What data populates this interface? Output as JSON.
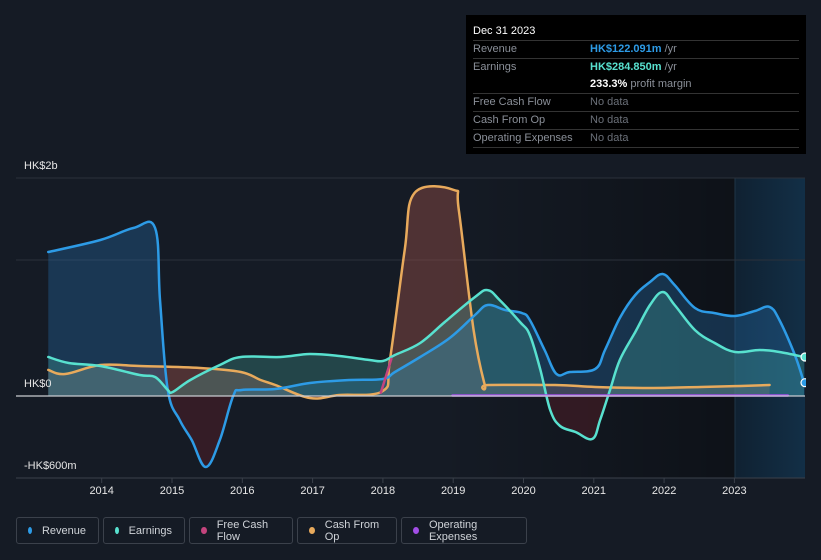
{
  "tooltip": {
    "date": "Dec 31 2023",
    "rows": [
      {
        "label": "Revenue",
        "value": "HK$122.091m",
        "suffix": " /yr",
        "color": "#2d9be6"
      },
      {
        "label": "Earnings",
        "value": "HK$284.850m",
        "suffix": " /yr",
        "color": "#58e1cf"
      },
      {
        "label": "",
        "value": "233.3%",
        "suffix": " profit margin",
        "color": "#ffffff"
      },
      {
        "label": "Free Cash Flow",
        "value": "No data",
        "suffix": "",
        "color": "#6b7079"
      },
      {
        "label": "Cash From Op",
        "value": "No data",
        "suffix": "",
        "color": "#6b7079"
      },
      {
        "label": "Operating Expenses",
        "value": "No data",
        "suffix": "",
        "color": "#6b7079"
      }
    ]
  },
  "legend": [
    {
      "label": "Revenue",
      "color": "#2d9be6"
    },
    {
      "label": "Earnings",
      "color": "#58e1cf"
    },
    {
      "label": "Free Cash Flow",
      "color": "#c4447d"
    },
    {
      "label": "Cash From Op",
      "color": "#e8aa5c"
    },
    {
      "label": "Operating Expenses",
      "color": "#a24ee6"
    }
  ],
  "chart_data": {
    "type": "area",
    "title": "",
    "xlabel": "",
    "ylabel": "",
    "currency": "HK$",
    "units": "millions",
    "y_tick_labels": [
      "HK$2b",
      "HK$0",
      "-HK$600m"
    ],
    "y_ticks": [
      2000,
      0,
      -600
    ],
    "ylim": [
      -750,
      2000
    ],
    "x_tick_labels": [
      "2014",
      "2015",
      "2016",
      "2017",
      "2018",
      "2019",
      "2020",
      "2021",
      "2022",
      "2023"
    ],
    "x_ticks": [
      2014,
      2015,
      2016,
      2017,
      2018,
      2019,
      2020,
      2021,
      2022,
      2023
    ],
    "xlim": [
      2012.54,
      2024.08
    ],
    "forecast_start": 2023.0,
    "grid": true,
    "legend_position": "bottom",
    "series": [
      {
        "name": "Revenue",
        "color": "#2d9be6",
        "points": [
          [
            2013.24,
            1321
          ],
          [
            2013.98,
            1431
          ],
          [
            2014.45,
            1541
          ],
          [
            2014.76,
            1541
          ],
          [
            2014.83,
            881
          ],
          [
            2014.94,
            55
          ],
          [
            2015.11,
            -220
          ],
          [
            2015.28,
            -404
          ],
          [
            2015.48,
            -651
          ],
          [
            2015.68,
            -404
          ],
          [
            2015.87,
            0
          ],
          [
            2015.99,
            55
          ],
          [
            2016.47,
            64
          ],
          [
            2016.96,
            119
          ],
          [
            2017.53,
            147
          ],
          [
            2018.0,
            156
          ],
          [
            2018.17,
            220
          ],
          [
            2018.53,
            358
          ],
          [
            2018.95,
            532
          ],
          [
            2019.31,
            743
          ],
          [
            2019.49,
            835
          ],
          [
            2019.74,
            789
          ],
          [
            2019.98,
            761
          ],
          [
            2020.09,
            697
          ],
          [
            2020.3,
            422
          ],
          [
            2020.47,
            202
          ],
          [
            2020.66,
            220
          ],
          [
            2021.02,
            248
          ],
          [
            2021.16,
            422
          ],
          [
            2021.37,
            716
          ],
          [
            2021.59,
            927
          ],
          [
            2021.8,
            1046
          ],
          [
            2021.98,
            1119
          ],
          [
            2022.15,
            1018
          ],
          [
            2022.44,
            807
          ],
          [
            2022.72,
            761
          ],
          [
            2023.01,
            734
          ],
          [
            2023.29,
            780
          ],
          [
            2023.5,
            817
          ],
          [
            2023.64,
            697
          ],
          [
            2023.86,
            376
          ],
          [
            2023.99,
            122
          ]
        ]
      },
      {
        "name": "Earnings",
        "color": "#58e1cf",
        "points": [
          [
            2013.24,
            358
          ],
          [
            2013.53,
            303
          ],
          [
            2013.98,
            275
          ],
          [
            2014.54,
            193
          ],
          [
            2014.76,
            174
          ],
          [
            2014.94,
            55
          ],
          [
            2015.01,
            37
          ],
          [
            2015.26,
            147
          ],
          [
            2015.68,
            284
          ],
          [
            2015.98,
            358
          ],
          [
            2016.54,
            358
          ],
          [
            2016.96,
            385
          ],
          [
            2017.38,
            367
          ],
          [
            2017.81,
            330
          ],
          [
            2018.0,
            321
          ],
          [
            2018.17,
            376
          ],
          [
            2018.53,
            486
          ],
          [
            2018.88,
            679
          ],
          [
            2019.31,
            908
          ],
          [
            2019.49,
            972
          ],
          [
            2019.66,
            881
          ],
          [
            2019.95,
            679
          ],
          [
            2020.09,
            560
          ],
          [
            2020.24,
            239
          ],
          [
            2020.38,
            -128
          ],
          [
            2020.52,
            -275
          ],
          [
            2020.74,
            -330
          ],
          [
            2020.98,
            -394
          ],
          [
            2021.09,
            -220
          ],
          [
            2021.23,
            55
          ],
          [
            2021.37,
            330
          ],
          [
            2021.59,
            587
          ],
          [
            2021.8,
            835
          ],
          [
            2021.98,
            954
          ],
          [
            2022.15,
            835
          ],
          [
            2022.44,
            605
          ],
          [
            2022.72,
            486
          ],
          [
            2023.01,
            404
          ],
          [
            2023.36,
            422
          ],
          [
            2023.64,
            404
          ],
          [
            2023.99,
            358
          ]
        ]
      },
      {
        "name": "Free Cash Flow",
        "color": "#c4447d",
        "points": [
          [
            2017.97,
            30
          ],
          [
            2018.12,
            340
          ]
        ]
      },
      {
        "name": "Cash From Op",
        "color": "#e8aa5c",
        "points": [
          [
            2013.24,
            239
          ],
          [
            2013.48,
            202
          ],
          [
            2013.98,
            284
          ],
          [
            2014.54,
            275
          ],
          [
            2015.4,
            257
          ],
          [
            2015.98,
            220
          ],
          [
            2016.26,
            147
          ],
          [
            2016.47,
            101
          ],
          [
            2016.96,
            -18
          ],
          [
            2017.38,
            9
          ],
          [
            2018.0,
            46
          ],
          [
            2018.1,
            330
          ],
          [
            2018.31,
            1339
          ],
          [
            2018.45,
            1862
          ],
          [
            2019.01,
            1890
          ],
          [
            2019.08,
            1706
          ],
          [
            2019.29,
            605
          ],
          [
            2019.45,
            101
          ],
          [
            2019.5,
            101
          ],
          [
            2020.45,
            101
          ],
          [
            2021.02,
            83
          ],
          [
            2021.8,
            73
          ],
          [
            2022.52,
            83
          ],
          [
            2023.09,
            92
          ],
          [
            2023.5,
            101
          ]
        ]
      },
      {
        "name": "Operating Expenses",
        "color": "#a24ee6",
        "points": [
          [
            2018.99,
            5
          ],
          [
            2023.76,
            5
          ]
        ]
      }
    ]
  }
}
